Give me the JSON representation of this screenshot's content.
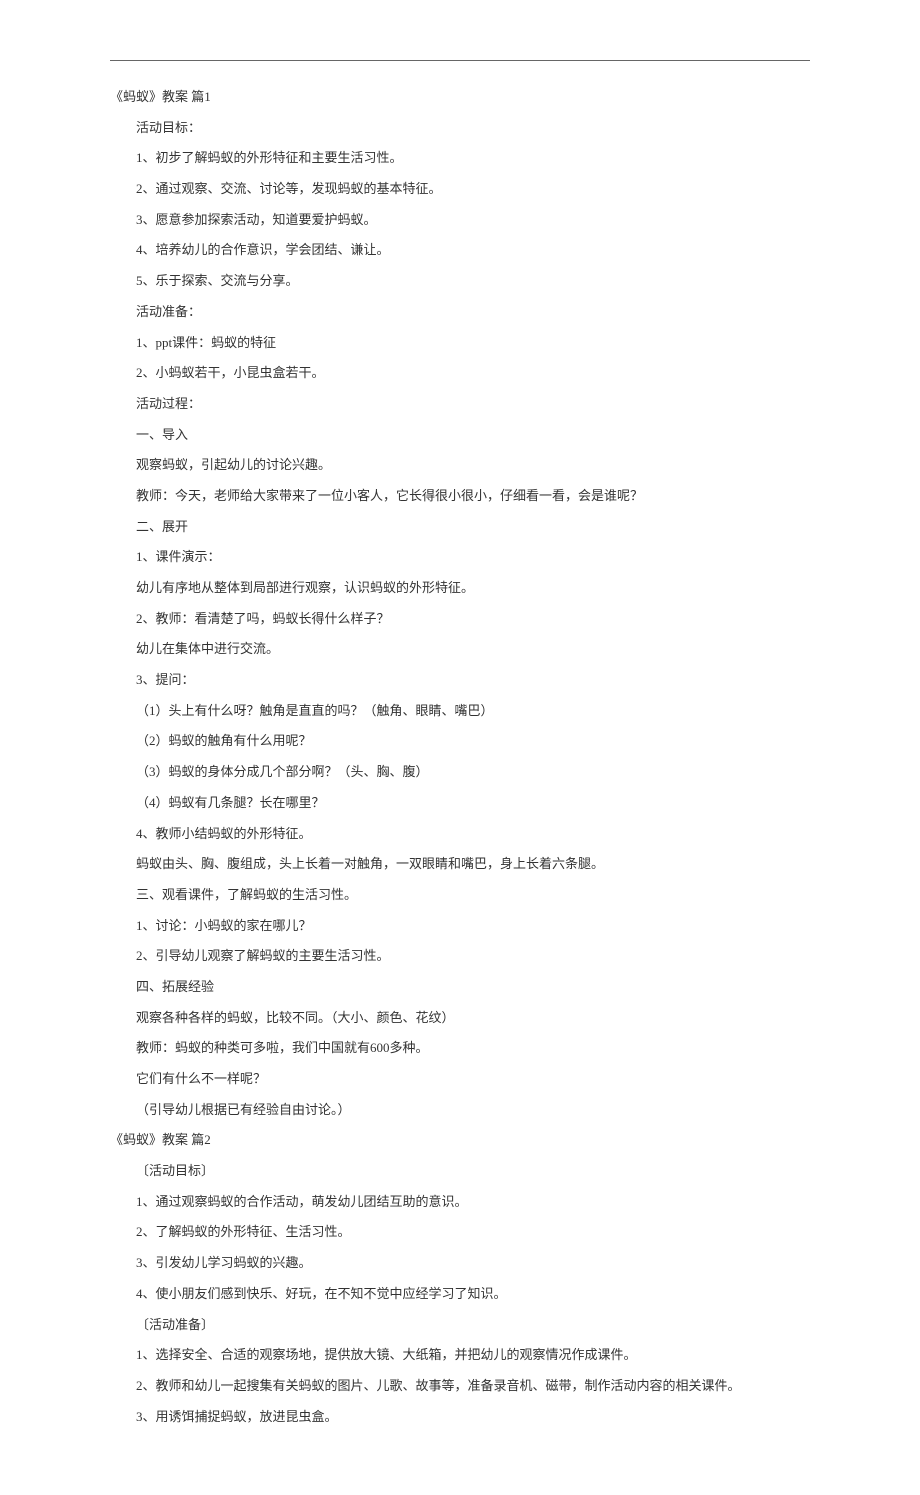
{
  "section1": {
    "title": "《蚂蚁》教案 篇1",
    "lines": [
      "活动目标：",
      "1、初步了解蚂蚁的外形特征和主要生活习性。",
      "2、通过观察、交流、讨论等，发现蚂蚁的基本特征。",
      "3、愿意参加探索活动，知道要爱护蚂蚁。",
      "4、培养幼儿的合作意识，学会团结、谦让。",
      "5、乐于探索、交流与分享。",
      "活动准备：",
      "1、ppt课件：蚂蚁的特征",
      "2、小蚂蚁若干，小昆虫盒若干。",
      "活动过程：",
      "一、导入",
      "观察蚂蚁，引起幼儿的讨论兴趣。",
      "教师：今天，老师给大家带来了一位小客人，它长得很小很小，仔细看一看，会是谁呢？",
      "二、展开",
      "1、课件演示：",
      "幼儿有序地从整体到局部进行观察，认识蚂蚁的外形特征。",
      "2、教师：看清楚了吗，蚂蚁长得什么样子？",
      "幼儿在集体中进行交流。",
      "3、提问：",
      "（1）头上有什么呀？触角是直直的吗？（触角、眼睛、嘴巴）",
      "（2）蚂蚁的触角有什么用呢？",
      "（3）蚂蚁的身体分成几个部分啊？（头、胸、腹）",
      "（4）蚂蚁有几条腿？长在哪里？",
      "4、教师小结蚂蚁的外形特征。",
      "蚂蚁由头、胸、腹组成，头上长着一对触角，一双眼睛和嘴巴，身上长着六条腿。",
      "三、观看课件，了解蚂蚁的生活习性。",
      "1、讨论：小蚂蚁的家在哪儿？",
      "2、引导幼儿观察了解蚂蚁的主要生活习性。",
      "四、拓展经验",
      "观察各种各样的蚂蚁，比较不同。（大小、颜色、花纹）",
      "教师：蚂蚁的种类可多啦，我们中国就有600多种。",
      "它们有什么不一样呢？",
      "（引导幼儿根据已有经验自由讨论。）"
    ]
  },
  "section2": {
    "title": "《蚂蚁》教案 篇2",
    "lines": [
      "〔活动目标〕",
      "1、通过观察蚂蚁的合作活动，萌发幼儿团结互助的意识。",
      "2、了解蚂蚁的外形特征、生活习性。",
      "3、引发幼儿学习蚂蚁的兴趣。",
      "4、使小朋友们感到快乐、好玩，在不知不觉中应经学习了知识。",
      "〔活动准备〕",
      "1、选择安全、合适的观察场地，提供放大镜、大纸箱，并把幼儿的观察情况作成课件。",
      "2、教师和幼儿一起搜集有关蚂蚁的图片、儿歌、故事等，准备录音机、磁带，制作活动内容的相关课件。",
      "3、用诱饵捕捉蚂蚁，放进昆虫盒。"
    ]
  }
}
